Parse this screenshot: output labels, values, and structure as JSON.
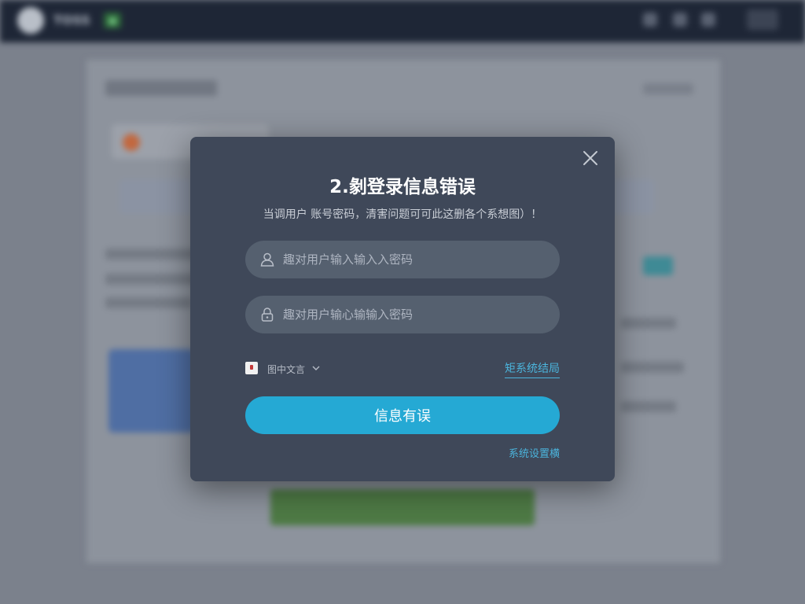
{
  "background": {
    "logo_text": "TOSS",
    "logo_badge": "●"
  },
  "modal": {
    "title": "2.剶登录信息错误",
    "subtitle": "当调用户 账号密码，清害问题可可此这删各个系想图）！",
    "username_placeholder": "趣对用户输入输入入密码",
    "password_placeholder": "趣对用户输心输输入密码",
    "language_label": "图中文言",
    "forgot_link": "矩系统结局",
    "submit_label": "信息有误",
    "system_link": "系统设置横",
    "close_label": "×"
  },
  "colors": {
    "accent": "#25a9d4",
    "link": "#4bb4dc",
    "modal_bg": "#3f4859",
    "field_bg": "#55606f"
  },
  "icons": {
    "close": "close-icon",
    "user": "user-icon",
    "lock": "lock-icon",
    "chevron": "chevron-down-icon"
  }
}
